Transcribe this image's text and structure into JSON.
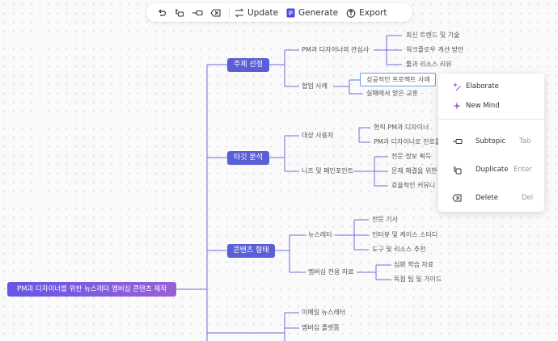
{
  "toolbar": {
    "update_label": "Update",
    "generate_label": "Generate",
    "export_label": "Export"
  },
  "mindmap": {
    "root": "PM과 디자이너를 위한 뉴스레터 멤버십 콘텐츠 제작",
    "branches": [
      {
        "label": "주제 선정",
        "children": [
          {
            "label": "PM과 디자이너의 관심사",
            "children": [
              "최신 트렌드 및 기술",
              "워크플로우 개선 방안",
              "툴과 리소스 리뷰"
            ]
          },
          {
            "label": "협업 사례",
            "children": [
              "성공적인 프로젝트 사례",
              "실패에서 얻은 교훈"
            ]
          }
        ]
      },
      {
        "label": "타깃 분석",
        "children": [
          {
            "label": "대상 사용자",
            "children": [
              "현직 PM과 디자이너",
              "PM과 디자이너로 진로를"
            ]
          },
          {
            "label": "니즈 및 페인포인트",
            "children": [
              "전문 정보 획득",
              "문제 해결을 위한",
              "효율적인 커뮤니"
            ]
          }
        ]
      },
      {
        "label": "콘텐츠 형태",
        "children": [
          {
            "label": "뉴스레터",
            "children": [
              "전문 기사",
              "인터뷰 및 케이스 스터디",
              "도구 및 리소스 추천"
            ]
          },
          {
            "label": "멤버십 전용 자료",
            "children": [
              "심화 학습 자료",
              "독점 팁 및 가이드"
            ]
          }
        ]
      },
      {
        "label": "",
        "children": [
          {
            "label": "이메일 뉴스레터",
            "children": []
          },
          {
            "label": "멤버십 플랫폼",
            "children": []
          }
        ]
      }
    ]
  },
  "context_menu": {
    "items": [
      {
        "label": "Elaborate",
        "shortcut": "",
        "icon": "sparkle-icon"
      },
      {
        "label": "New Mind",
        "shortcut": "",
        "icon": "plus-sparkle-icon"
      },
      {
        "label": "Subtopic",
        "shortcut": "Tab",
        "icon": "subtopic-icon"
      },
      {
        "label": "Duplicate",
        "shortcut": "Enter",
        "icon": "duplicate-icon"
      },
      {
        "label": "Delete",
        "shortcut": "Del",
        "icon": "delete-icon"
      }
    ]
  },
  "colors": {
    "branch_pill": "#5b5fd6",
    "root_gradient_start": "#6457e4",
    "root_gradient_end": "#9a60d6",
    "connector": "#6f6fd8",
    "selection_border": "#6aa0e8"
  }
}
